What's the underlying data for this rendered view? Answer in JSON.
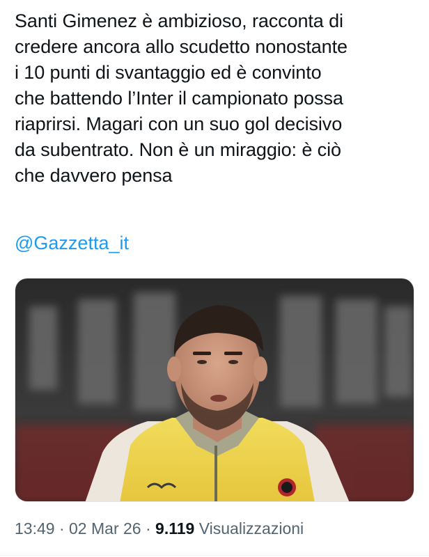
{
  "tweet": {
    "text": "Santi Gimenez è ambizioso, racconta di\ncredere ancora allo scudetto nonostante\ni 10 punti di svantaggio ed è convinto\nche battendo l’Inter il campionato possa\nriaprirsi. Magari con un suo gol decisivo\nda subentrato. Non è un miraggio: è ciò\nche davvero pensa",
    "mention": "@Gazzetta_it"
  },
  "media": {
    "description_icon": "player-photo"
  },
  "meta": {
    "time": "13:49",
    "date": "02 Mar 26",
    "separator": "·",
    "views_count": "9.119",
    "views_label": "Visualizzazioni"
  },
  "colors": {
    "link": "#1d9bf0",
    "secondary": "#536471",
    "text": "#0f1419"
  }
}
